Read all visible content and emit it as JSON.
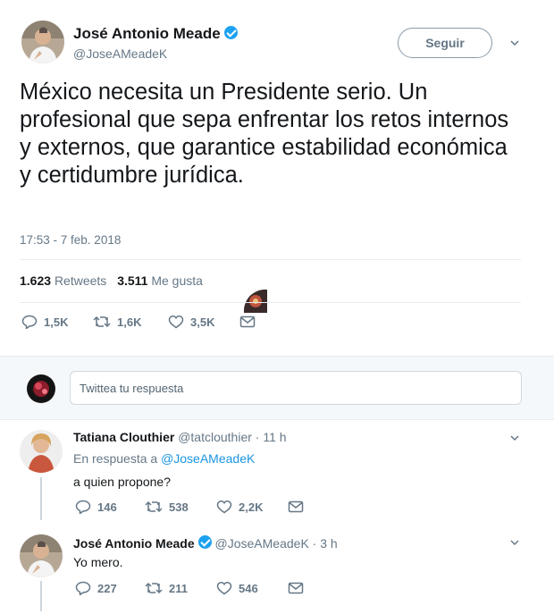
{
  "main_tweet": {
    "author_name": "José Antonio Meade",
    "handle": "@JoseAMeadeK",
    "follow_label": "Seguir",
    "text": "México necesita un Presidente serio. Un profesional que sepa enfrentar los retos internos y externos, que garantice estabilidad económica y certidumbre jurídica.",
    "timestamp": "17:53 - 7 feb. 2018",
    "retweets_count": "1.623",
    "retweets_label": "Retweets",
    "likes_count": "3.511",
    "likes_label": "Me gusta",
    "actions": {
      "replies": "1,5K",
      "retweets": "1,6K",
      "likes": "3,5K"
    }
  },
  "reply_box": {
    "placeholder": "Twittea tu respuesta"
  },
  "replies": [
    {
      "author_name": "Tatiana Clouthier",
      "meta": "@tatclouthier · 11 h",
      "in_reply_prefix": "En respuesta a",
      "in_reply_handle": "@JoseAMeadeK",
      "text": "a quien propone?",
      "actions": {
        "replies": "146",
        "retweets": "538",
        "likes": "2,2K"
      }
    },
    {
      "author_name": "José Antonio Meade",
      "meta": "@JoseAMeadeK · 3 h",
      "text": "Yo mero.",
      "actions": {
        "replies": "227",
        "retweets": "211",
        "likes": "546"
      }
    }
  ],
  "colors": {
    "text": "#14171a",
    "secondary": "#657786",
    "link": "#1b95e0",
    "verified": "#1da1f2",
    "divider": "#e6ecf0",
    "reply_bg": "#f5f8fa"
  }
}
